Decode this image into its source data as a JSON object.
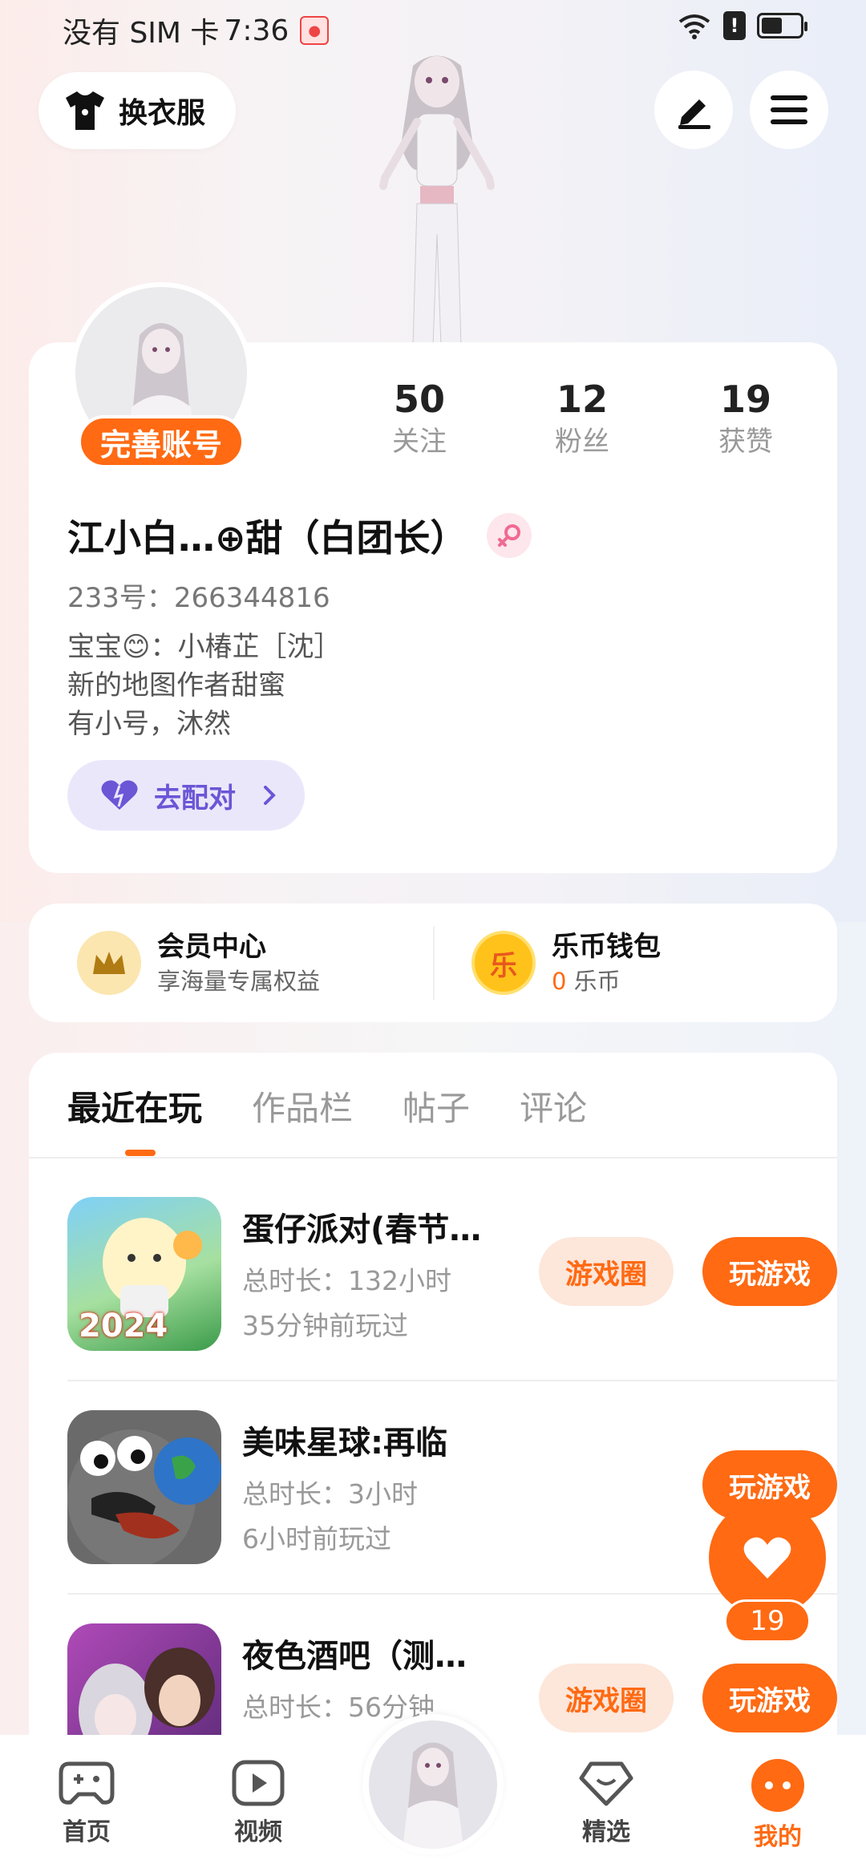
{
  "status_bar": {
    "carrier": "没有 SIM 卡",
    "time": "7:36",
    "alert": "!"
  },
  "header": {
    "dress_label": "换衣服",
    "edit_icon": "pen-icon",
    "menu_icon": "hamburger-menu-icon"
  },
  "profile": {
    "complete_badge": "完善账号",
    "stats": [
      {
        "value": "50",
        "label": "关注"
      },
      {
        "value": "12",
        "label": "粉丝"
      },
      {
        "value": "19",
        "label": "获赞"
      }
    ],
    "nickname": "江小白…⊕甜（白团长）",
    "uid": "233号：266344816",
    "bio_lines": [
      "宝宝😊：小椿芷［沈］",
      "新的地图作者甜蜜",
      "有小号，沐然"
    ],
    "match_label": "去配对"
  },
  "benefits": {
    "member": {
      "title": "会员中心",
      "subtitle": "享海量专属权益"
    },
    "wallet": {
      "title": "乐币钱包",
      "amount": "0",
      "unit": "乐币",
      "icon_char": "乐"
    }
  },
  "tabs": [
    "最近在玩",
    "作品栏",
    "帖子",
    "评论"
  ],
  "games": [
    {
      "title": "蛋仔派对(春节…",
      "duration": "总时长：132小时",
      "last_played": "35分钟前玩过",
      "circle_btn": "游戏圈",
      "play_btn": "玩游戏",
      "cover_text": "2024"
    },
    {
      "title": "美味星球:再临",
      "duration": "总时长：3小时",
      "last_played": "6小时前玩过",
      "play_btn": "玩游戏"
    },
    {
      "title": "夜色酒吧（测…",
      "duration": "总时长：56分钟",
      "circle_btn": "游戏圈",
      "play_btn": "玩游戏"
    }
  ],
  "like_fab": {
    "count": "19"
  },
  "bottom_nav": [
    {
      "label": "首页",
      "icon": "gamepad-icon"
    },
    {
      "label": "视频",
      "icon": "video-play-icon"
    },
    {
      "label": "精选",
      "icon": "heart-diamond-icon"
    },
    {
      "label": "我的",
      "icon": "face-icon"
    }
  ],
  "colors": {
    "accent": "#ff6a13",
    "purple": "#6b56d6"
  }
}
